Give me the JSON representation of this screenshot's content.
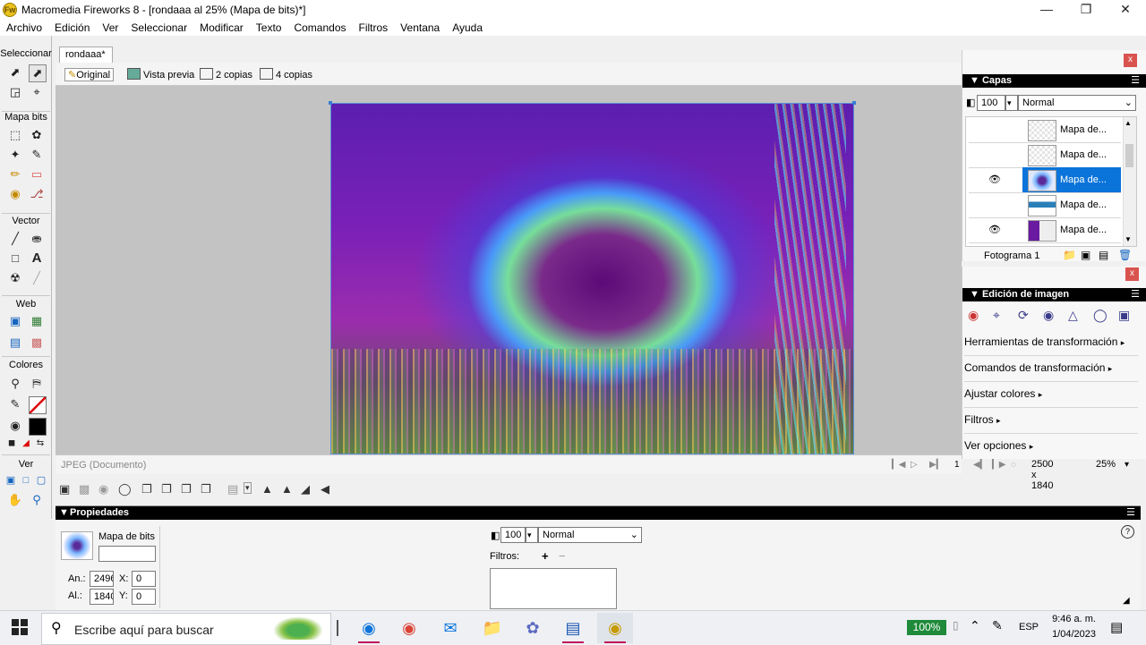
{
  "window": {
    "title": "Macromedia Fireworks 8 - [rondaaa al  25% (Mapa de bits)*]",
    "app_icon": "fireworks-logo",
    "controls": [
      "minimize",
      "restore",
      "close"
    ]
  },
  "menu": [
    "Archivo",
    "Edición",
    "Ver",
    "Seleccionar",
    "Modificar",
    "Texto",
    "Comandos",
    "Filtros",
    "Ventana",
    "Ayuda"
  ],
  "tools": {
    "sections": [
      "Seleccionar",
      "Mapa bits",
      "Vector",
      "Web",
      "Colores",
      "Ver"
    ]
  },
  "document": {
    "tab": "rondaaa*",
    "views": [
      "Original",
      "Vista previa",
      "2 copias",
      "4 copias"
    ],
    "status_format": "JPEG (Documento)",
    "frame_number": "1",
    "size": "2500 x 1840",
    "zoom": "25%"
  },
  "layers_panel": {
    "title": "Capas",
    "opacity": "100",
    "blend": "Normal",
    "layers": [
      {
        "label": "Mapa de...",
        "visible": false,
        "selected": false
      },
      {
        "label": "Mapa de...",
        "visible": false,
        "selected": false
      },
      {
        "label": "Mapa de...",
        "visible": true,
        "selected": true
      },
      {
        "label": "Mapa de...",
        "visible": false,
        "selected": false
      },
      {
        "label": "Mapa de...",
        "visible": true,
        "selected": false
      }
    ],
    "frame": "Fotograma 1"
  },
  "image_edit_panel": {
    "title": "Edición de imagen",
    "items": [
      "Herramientas de transformación",
      "Comandos de transformación",
      "Ajustar colores",
      "Filtros",
      "Ver opciones"
    ]
  },
  "properties": {
    "title": "Propiedades",
    "object_type": "Mapa de bits",
    "name_value": "",
    "width_label": "An.:",
    "width_value": "2496",
    "height_label": "Al.:",
    "height_value": "1840",
    "x_label": "X:",
    "x_value": "0",
    "y_label": "Y:",
    "y_value": "0",
    "opacity": "100",
    "blend": "Normal",
    "filters_label": "Filtros:"
  },
  "taskbar": {
    "search_placeholder": "Escribe aquí para buscar",
    "battery": "100%",
    "language": "ESP",
    "time": "9:46 a. m.",
    "date": "1/04/2023"
  },
  "colors": {
    "accent": "#0a74da",
    "panel_header": "#000000",
    "close_red": "#d9534f"
  }
}
